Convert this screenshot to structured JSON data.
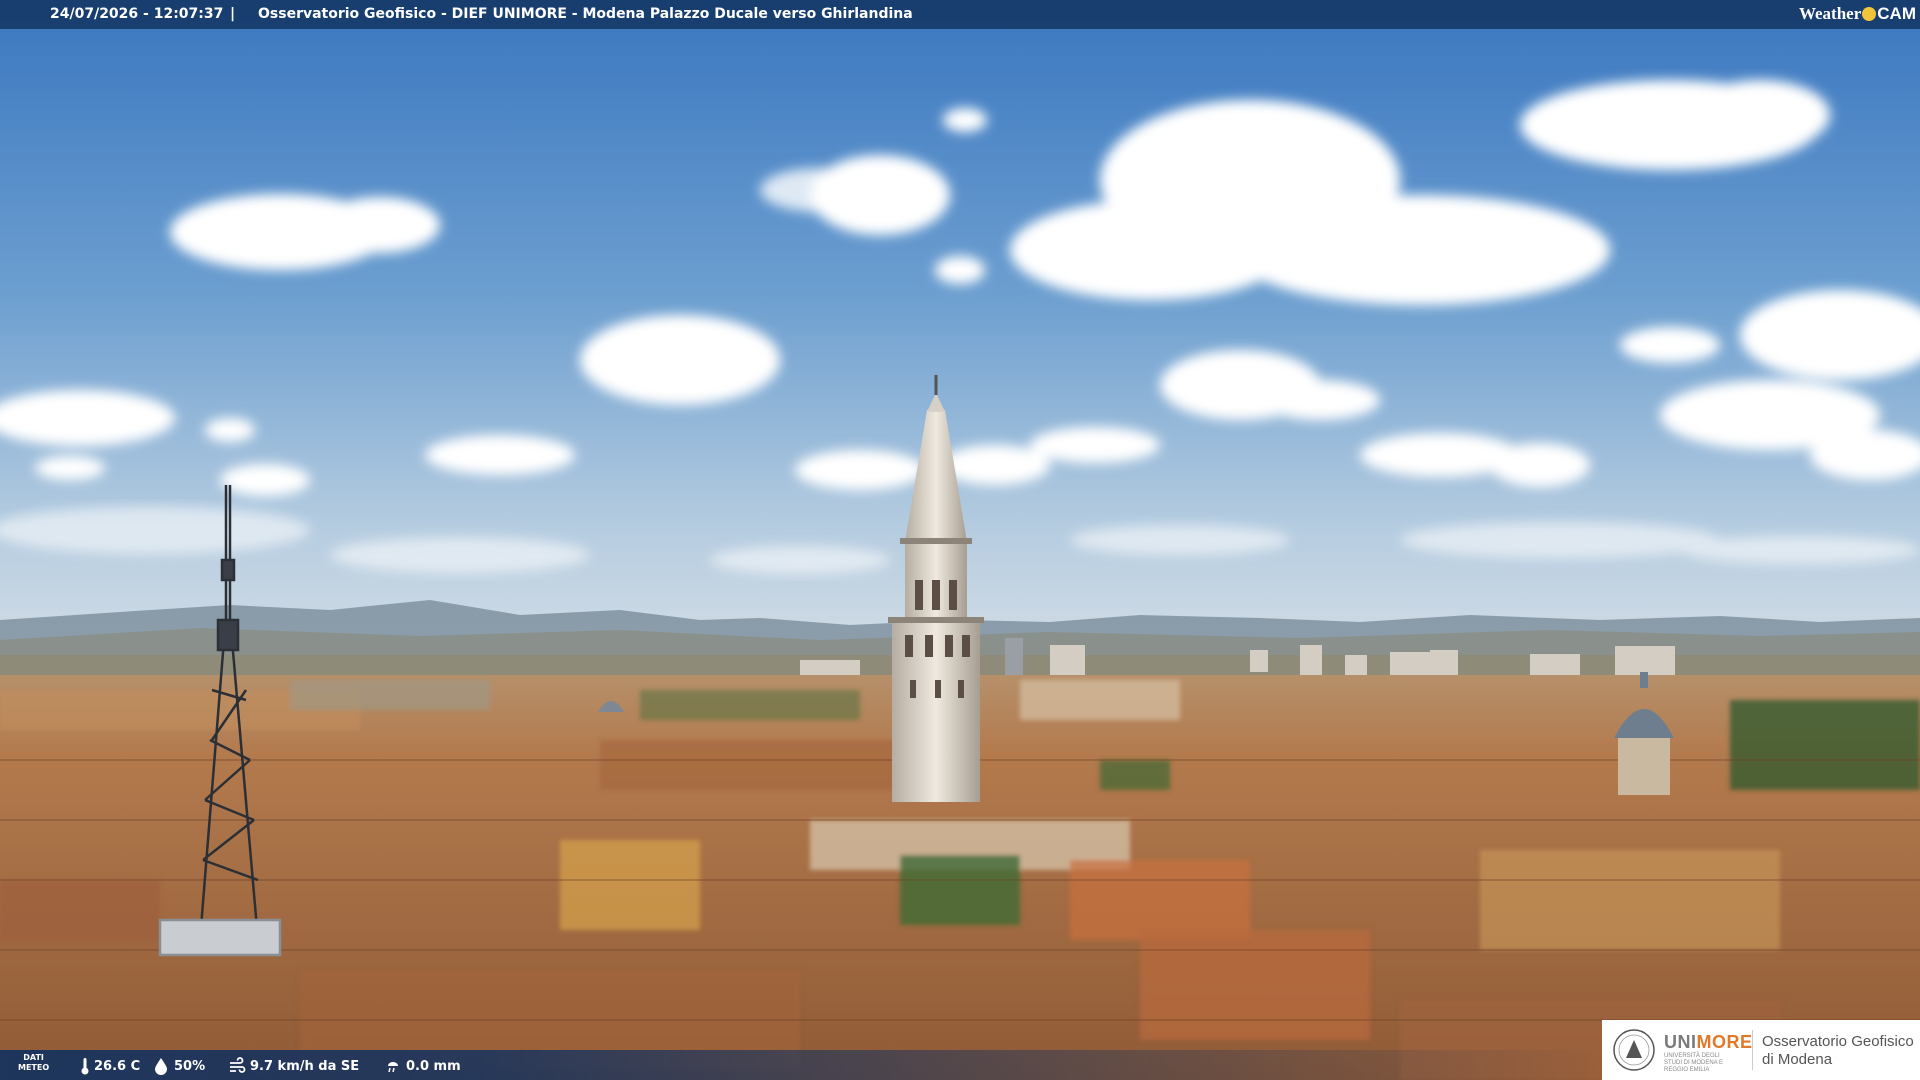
{
  "overlay": {
    "timestamp": "24/07/2026 - 12:07:37",
    "separator": "|",
    "title": "Osservatorio Geofisico - DIEF UNIMORE - Modena Palazzo Ducale verso Ghirlandina",
    "brand_weather": "Weather",
    "brand_cam": "CAM"
  },
  "weather": {
    "label_line1": "DATI",
    "label_line2": "METEO",
    "temperature": "26.6 C",
    "humidity": "50%",
    "wind": "9.7 km/h da SE",
    "rain": "0.0 mm"
  },
  "logo": {
    "uni": "UNI",
    "more": "MORE",
    "uni_sub": "UNIVERSITÀ DEGLI STUDI DI MODENA E REGGIO EMILIA",
    "line1": "Osservatorio Geofisico",
    "line2": "di Modena"
  },
  "colors": {
    "bar": "#163a69",
    "sky_top": "#3e7cc4",
    "sky_bottom": "#c9d9e6",
    "roof": "#b07648",
    "accent_orange": "#e0792a"
  },
  "icons": {
    "temperature": "thermometer-icon",
    "humidity": "droplet-icon",
    "wind": "wind-icon",
    "rain": "rain-icon"
  }
}
